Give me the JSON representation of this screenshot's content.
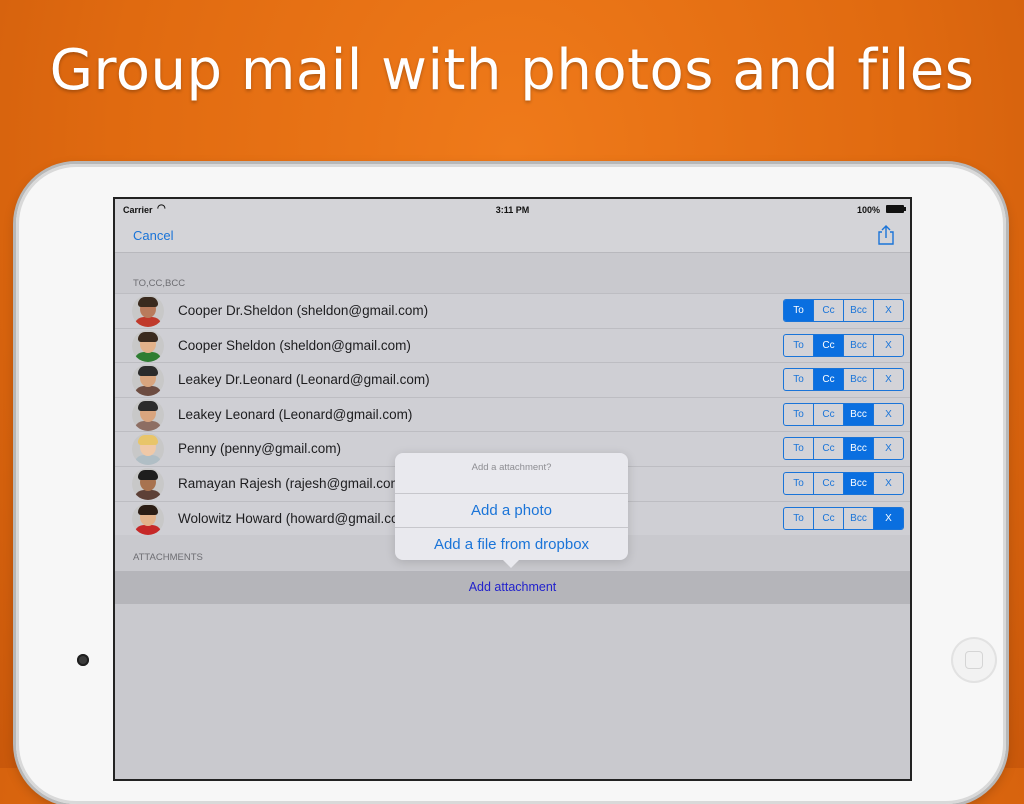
{
  "headline": "Group mail with photos and files",
  "status_bar": {
    "carrier": "Carrier",
    "time": "3:11 PM",
    "battery": "100%"
  },
  "navbar": {
    "cancel_label": "Cancel",
    "share_icon": "share-icon"
  },
  "recipients_section": {
    "label": "TO,CC,BCC",
    "segment_labels": [
      "To",
      "Cc",
      "Bcc",
      "X"
    ],
    "rows": [
      {
        "name": "Cooper Dr.Sheldon (sheldon@gmail.com)",
        "selected": "To"
      },
      {
        "name": "Cooper Sheldon (sheldon@gmail.com)",
        "selected": "Cc"
      },
      {
        "name": "Leakey Dr.Leonard (Leonard@gmail.com)",
        "selected": "Cc"
      },
      {
        "name": "Leakey Leonard (Leonard@gmail.com)",
        "selected": "Bcc"
      },
      {
        "name": "Penny (penny@gmail.com)",
        "selected": "Bcc"
      },
      {
        "name": "Ramayan Rajesh (rajesh@gmail.com)",
        "selected": "Bcc"
      },
      {
        "name": "Wolowitz Howard (howard@gmail.com)",
        "selected": "X"
      }
    ]
  },
  "attachments_section": {
    "label": "ATTACHMENTS",
    "add_button": "Add attachment"
  },
  "popover": {
    "title": "Add a attachment?",
    "options": [
      "Add a photo",
      "Add a file from dropbox"
    ]
  },
  "colors": {
    "accent": "#1a74d8",
    "background": "#e06a10"
  }
}
